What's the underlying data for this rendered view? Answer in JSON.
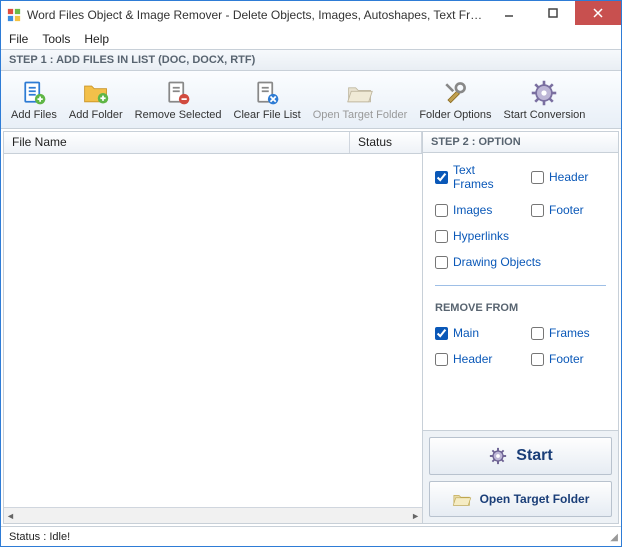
{
  "window": {
    "title": "Word Files Object & Image Remover - Delete Objects, Images, Autoshapes, Text Frames and H..."
  },
  "menubar": {
    "file": "File",
    "tools": "Tools",
    "help": "Help"
  },
  "step1_label": "STEP 1 : ADD FILES IN LIST (DOC, DOCX, RTF)",
  "toolbar": {
    "add_files": "Add Files",
    "add_folder": "Add Folder",
    "remove_selected": "Remove Selected",
    "clear_list": "Clear File List",
    "open_target": "Open Target Folder",
    "folder_options": "Folder Options",
    "start_conv": "Start Conversion"
  },
  "list": {
    "col_filename": "File Name",
    "col_status": "Status"
  },
  "step2_label": "STEP 2 : OPTION",
  "options": {
    "text_frames": "Text Frames",
    "header": "Header",
    "images": "Images",
    "footer": "Footer",
    "hyperlinks": "Hyperlinks",
    "drawing_objects": "Drawing Objects",
    "remove_from": "REMOVE FROM",
    "main": "Main",
    "frames": "Frames",
    "header2": "Header",
    "footer2": "Footer"
  },
  "buttons": {
    "start": "Start",
    "open_target": "Open Target Folder"
  },
  "statusbar": "Status  :  Idle!"
}
